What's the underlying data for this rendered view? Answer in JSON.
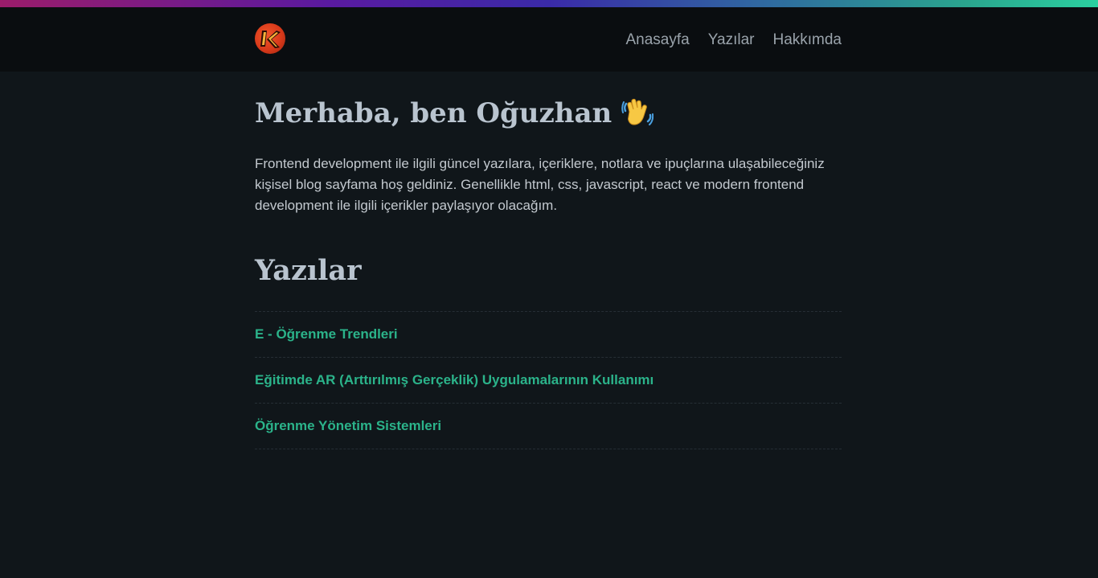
{
  "colors": {
    "background": "#10161a",
    "header_background": "#0a0d10",
    "link_accent": "#2bb38a",
    "heading": "#b9c4cf",
    "logo": "#e0481f"
  },
  "header": {
    "logo_icon": "logo-k-icon",
    "nav": [
      {
        "label": "Anasayfa"
      },
      {
        "label": "Yazılar"
      },
      {
        "label": "Hakkımda"
      }
    ]
  },
  "hero": {
    "title": "Merhaba, ben Oğuzhan",
    "title_icon": "waving-hand-icon",
    "intro": "Frontend development ile ilgili güncel yazılara, içeriklere, notlara ve ipuçlarına ulaşabileceğiniz kişisel blog sayfama hoş geldiniz. Genellikle html, css, javascript, react ve modern frontend development ile ilgili içerikler paylaşıyor olacağım."
  },
  "posts": {
    "section_title": "Yazılar",
    "items": [
      {
        "title": "E - Öğrenme Trendleri"
      },
      {
        "title": "Eğitimde AR (Arttırılmış Gerçeklik) Uygulamalarının Kullanımı"
      },
      {
        "title": "Öğrenme Yönetim Sistemleri"
      }
    ]
  }
}
